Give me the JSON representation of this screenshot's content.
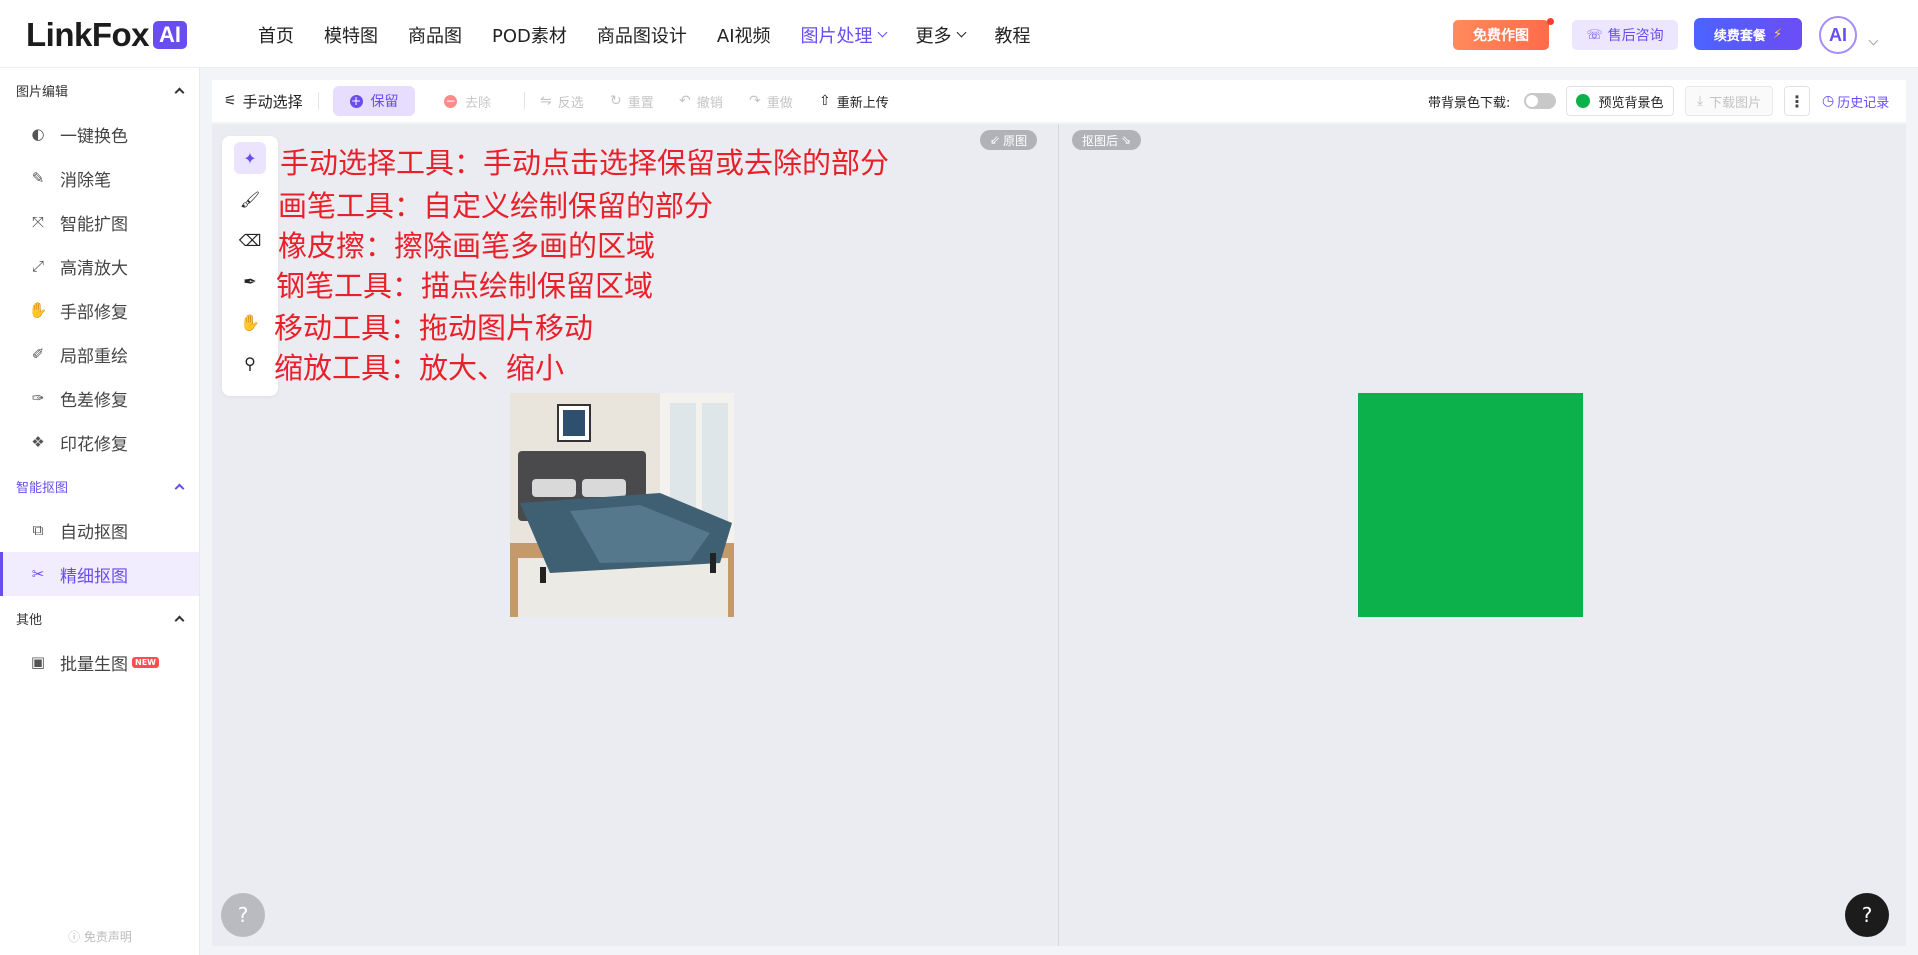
{
  "logo": {
    "text": "LinkFox",
    "badge": "AI"
  },
  "nav": {
    "items": [
      {
        "label": "首页"
      },
      {
        "label": "模特图"
      },
      {
        "label": "商品图"
      },
      {
        "label": "POD素材"
      },
      {
        "label": "商品图设计"
      },
      {
        "label": "AI视频"
      },
      {
        "label": "图片处理",
        "active": true,
        "dropdown": true
      },
      {
        "label": "更多",
        "dropdown": true
      },
      {
        "label": "教程"
      }
    ],
    "free_draw": "免费作图",
    "after_sales": "售后咨询",
    "renew": "续费套餐",
    "avatar": "AI"
  },
  "sidebar": {
    "sections": [
      {
        "title": "图片编辑",
        "items": [
          {
            "label": "一键换色",
            "icon": "color-swap-icon"
          },
          {
            "label": "消除笔",
            "icon": "eraser-pen-icon"
          },
          {
            "label": "智能扩图",
            "icon": "expand-icon"
          },
          {
            "label": "高清放大",
            "icon": "upscale-icon"
          },
          {
            "label": "手部修复",
            "icon": "hand-icon"
          },
          {
            "label": "局部重绘",
            "icon": "repaint-icon"
          },
          {
            "label": "色差修复",
            "icon": "color-fix-icon"
          },
          {
            "label": "印花修复",
            "icon": "print-fix-icon"
          }
        ]
      },
      {
        "title": "智能抠图",
        "items": [
          {
            "label": "自动抠图",
            "icon": "auto-cutout-icon"
          },
          {
            "label": "精细抠图",
            "icon": "fine-cutout-icon",
            "active": true
          }
        ]
      },
      {
        "title": "其他",
        "items": [
          {
            "label": "批量生图",
            "icon": "batch-image-icon",
            "badge": "NEW"
          }
        ]
      }
    ],
    "disclaimer": "免责声明"
  },
  "toolbar": {
    "manual_select": "手动选择",
    "keep": "保留",
    "remove": "去除",
    "invert": "反选",
    "reset": "重置",
    "undo": "撤销",
    "redo": "重做",
    "reupload": "重新上传",
    "bg_download_label": "带背景色下载:",
    "preview_bg": "预览背景色",
    "download": "下载图片",
    "history": "历史记录",
    "preview_color": "#0db14b"
  },
  "canvas": {
    "original_tag": "原图",
    "after_tag": "抠图后",
    "annotations": [
      "手动选择工具：手动点击选择保留或去除的部分",
      "画笔工具：自定义绘制保留的部分",
      "橡皮擦：擦除画笔多画的区域",
      "钢笔工具：描点绘制保留区域",
      "移动工具：拖动图片移动",
      "缩放工具：放大、缩小"
    ],
    "result_color": "#0db14b",
    "help": "?"
  }
}
